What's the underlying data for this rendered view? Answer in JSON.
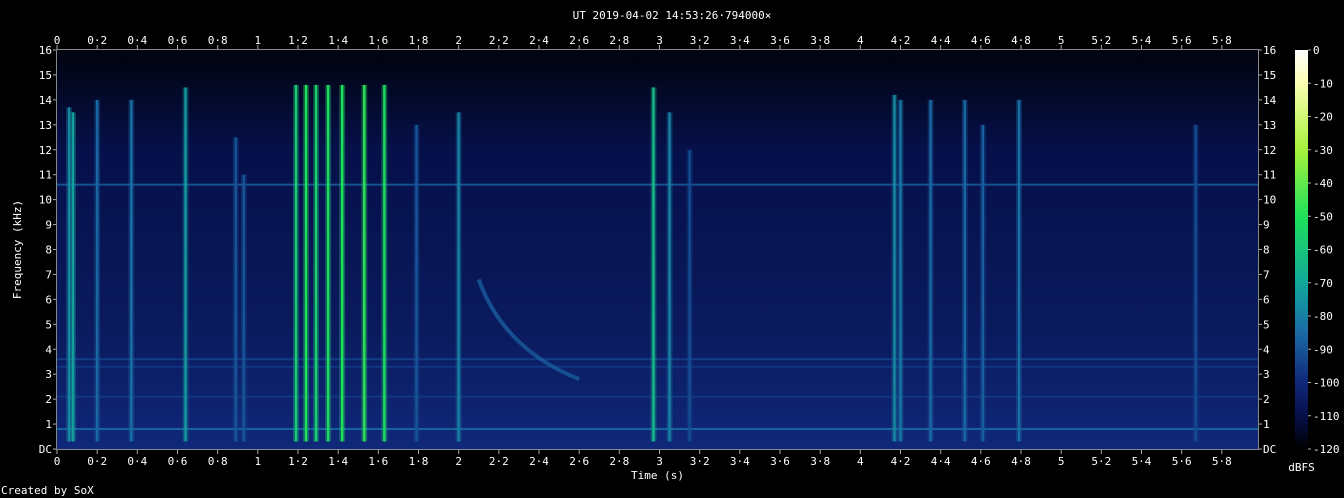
{
  "chart_data": {
    "type": "heatmap",
    "title": "UT 2019-04-02 14:53:26·794000×",
    "xlabel": "Time (s)",
    "ylabel": "Frequency (kHz)",
    "credit": "Created by SoX",
    "xlim": [
      0,
      5.98
    ],
    "ylim": [
      0,
      16
    ],
    "x_ticks": [
      "0",
      "0·2",
      "0·4",
      "0·6",
      "0·8",
      "1",
      "1·2",
      "1·4",
      "1·6",
      "1·8",
      "2",
      "2·2",
      "2·4",
      "2·6",
      "2·8",
      "3",
      "3·2",
      "3·4",
      "3·6",
      "3·8",
      "4",
      "4·2",
      "4·4",
      "4·6",
      "4·8",
      "5",
      "5·2",
      "5·4",
      "5·6",
      "5·8"
    ],
    "y_ticks": [
      "DC",
      "1",
      "2",
      "3",
      "4",
      "5",
      "6",
      "7",
      "8",
      "9",
      "10",
      "11",
      "12",
      "13",
      "14",
      "15",
      "16"
    ],
    "colorbar": {
      "label": "dBFS",
      "ticks": [
        "0",
        "-10",
        "-20",
        "-30",
        "-40",
        "-50",
        "-60",
        "-70",
        "-80",
        "-90",
        "-100",
        "-110",
        "-120"
      ],
      "range_db": [
        -120,
        0
      ],
      "stops": [
        {
          "db": 0,
          "color": "#ffffff"
        },
        {
          "db": -10,
          "color": "#fbffb0"
        },
        {
          "db": -30,
          "color": "#a6f03c"
        },
        {
          "db": -50,
          "color": "#1ee05a"
        },
        {
          "db": -70,
          "color": "#12a89a"
        },
        {
          "db": -85,
          "color": "#1a6aa6"
        },
        {
          "db": -100,
          "color": "#10287a"
        },
        {
          "db": -110,
          "color": "#06104a"
        },
        {
          "db": -120,
          "color": "#000000"
        }
      ]
    },
    "background_db": -108,
    "hum_lines": [
      {
        "freq_khz": 10.6,
        "db": -88
      },
      {
        "freq_khz": 0.8,
        "db": -84
      },
      {
        "freq_khz": 3.6,
        "db": -94
      },
      {
        "freq_khz": 3.3,
        "db": -96
      },
      {
        "freq_khz": 2.1,
        "db": -96
      }
    ],
    "transients": [
      {
        "time_s": 0.06,
        "fmin_khz": 0.3,
        "fmax_khz": 13.7,
        "db": -78
      },
      {
        "time_s": 0.08,
        "fmin_khz": 0.3,
        "fmax_khz": 13.5,
        "db": -72
      },
      {
        "time_s": 0.2,
        "fmin_khz": 0.3,
        "fmax_khz": 14.0,
        "db": -86
      },
      {
        "time_s": 0.37,
        "fmin_khz": 0.3,
        "fmax_khz": 14.0,
        "db": -84
      },
      {
        "time_s": 0.64,
        "fmin_khz": 0.3,
        "fmax_khz": 14.5,
        "db": -74
      },
      {
        "time_s": 0.89,
        "fmin_khz": 0.3,
        "fmax_khz": 12.5,
        "db": -90
      },
      {
        "time_s": 0.93,
        "fmin_khz": 0.3,
        "fmax_khz": 11.0,
        "db": -90
      },
      {
        "time_s": 1.19,
        "fmin_khz": 0.3,
        "fmax_khz": 14.6,
        "db": -58
      },
      {
        "time_s": 1.24,
        "fmin_khz": 0.3,
        "fmax_khz": 14.6,
        "db": -50
      },
      {
        "time_s": 1.29,
        "fmin_khz": 0.3,
        "fmax_khz": 14.6,
        "db": -56
      },
      {
        "time_s": 1.35,
        "fmin_khz": 0.3,
        "fmax_khz": 14.6,
        "db": -52
      },
      {
        "time_s": 1.42,
        "fmin_khz": 0.3,
        "fmax_khz": 14.6,
        "db": -50
      },
      {
        "time_s": 1.53,
        "fmin_khz": 0.3,
        "fmax_khz": 14.6,
        "db": -48
      },
      {
        "time_s": 1.63,
        "fmin_khz": 0.3,
        "fmax_khz": 14.6,
        "db": -52
      },
      {
        "time_s": 1.79,
        "fmin_khz": 0.3,
        "fmax_khz": 13.0,
        "db": -90
      },
      {
        "time_s": 2.0,
        "fmin_khz": 0.3,
        "fmax_khz": 13.5,
        "db": -80
      },
      {
        "time_s": 2.97,
        "fmin_khz": 0.3,
        "fmax_khz": 14.5,
        "db": -64
      },
      {
        "time_s": 3.05,
        "fmin_khz": 0.3,
        "fmax_khz": 13.5,
        "db": -80
      },
      {
        "time_s": 3.15,
        "fmin_khz": 0.3,
        "fmax_khz": 12.0,
        "db": -92
      },
      {
        "time_s": 4.17,
        "fmin_khz": 0.3,
        "fmax_khz": 14.2,
        "db": -78
      },
      {
        "time_s": 4.2,
        "fmin_khz": 0.3,
        "fmax_khz": 14.0,
        "db": -82
      },
      {
        "time_s": 4.35,
        "fmin_khz": 0.3,
        "fmax_khz": 14.0,
        "db": -86
      },
      {
        "time_s": 4.52,
        "fmin_khz": 0.3,
        "fmax_khz": 14.0,
        "db": -86
      },
      {
        "time_s": 4.61,
        "fmin_khz": 0.3,
        "fmax_khz": 13.0,
        "db": -88
      },
      {
        "time_s": 4.79,
        "fmin_khz": 0.3,
        "fmax_khz": 14.0,
        "db": -84
      },
      {
        "time_s": 5.67,
        "fmin_khz": 0.3,
        "fmax_khz": 13.0,
        "db": -92
      }
    ],
    "chirp": {
      "start_time_s": 2.1,
      "end_time_s": 2.6,
      "start_freq_khz": 6.8,
      "end_freq_khz": 2.8,
      "db": -88
    }
  }
}
